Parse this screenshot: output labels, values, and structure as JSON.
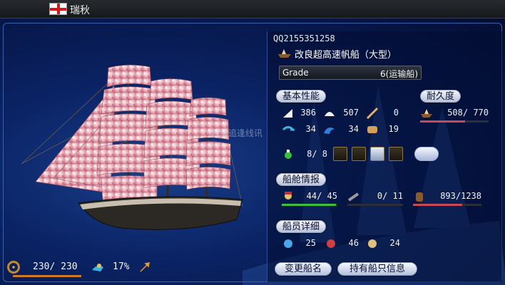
{
  "header": {
    "port_name": "瑞秋"
  },
  "watermark": "首海追逢线讯",
  "ship": {
    "owner_id": "QQ2155351258",
    "name": "改良超高速帆船（大型）",
    "grade_label": "Grade",
    "grade_value": "6(运输船)"
  },
  "basic": {
    "label": "基本性能",
    "vertical_sail": "386",
    "horizontal_sail": "507",
    "rowing": "0",
    "turning": "34",
    "wave_resistance": "34",
    "armor": "19",
    "cannon_rooms": "8/ 8"
  },
  "durability": {
    "label": "耐久度",
    "value": "508/ 770",
    "fraction": 0.66
  },
  "cabin": {
    "label": "船舱情报",
    "crew": "44/ 45",
    "crew_fraction": 0.98,
    "cannons": "0/ 11",
    "cannons_fraction": 0.0,
    "cargo": "893/1238",
    "cargo_fraction": 0.72
  },
  "crew_detail": {
    "label": "船员详细",
    "sailors": "25",
    "gunners": "46",
    "others": "24"
  },
  "bottom_left": {
    "helm_value": "230/ 230",
    "helm_fraction": 1.0,
    "percent": "17%"
  },
  "buttons": {
    "change_name": "变更船名",
    "owned_ships": "持有船只信息"
  },
  "colors": {
    "durability_bar": "#c94a56",
    "crew_bar": "#3cbf3c",
    "cargo_bar": "#c94a56",
    "helm_bar": "#d07a28"
  },
  "icons": [
    "flag-icon",
    "helm-icon",
    "crew-icon",
    "arrow-icon",
    "ship-icon",
    "vertical-sail-icon",
    "horizontal-sail-icon",
    "rowing-icon",
    "turning-icon",
    "wave-icon",
    "armor-icon",
    "cannon-room-icon",
    "upgrade-icon",
    "lifebuoy-icon",
    "fire-icon",
    "sailor-icon",
    "cannon-icon",
    "cargo-icon",
    "gunner-icon",
    "other-crew-icon"
  ]
}
